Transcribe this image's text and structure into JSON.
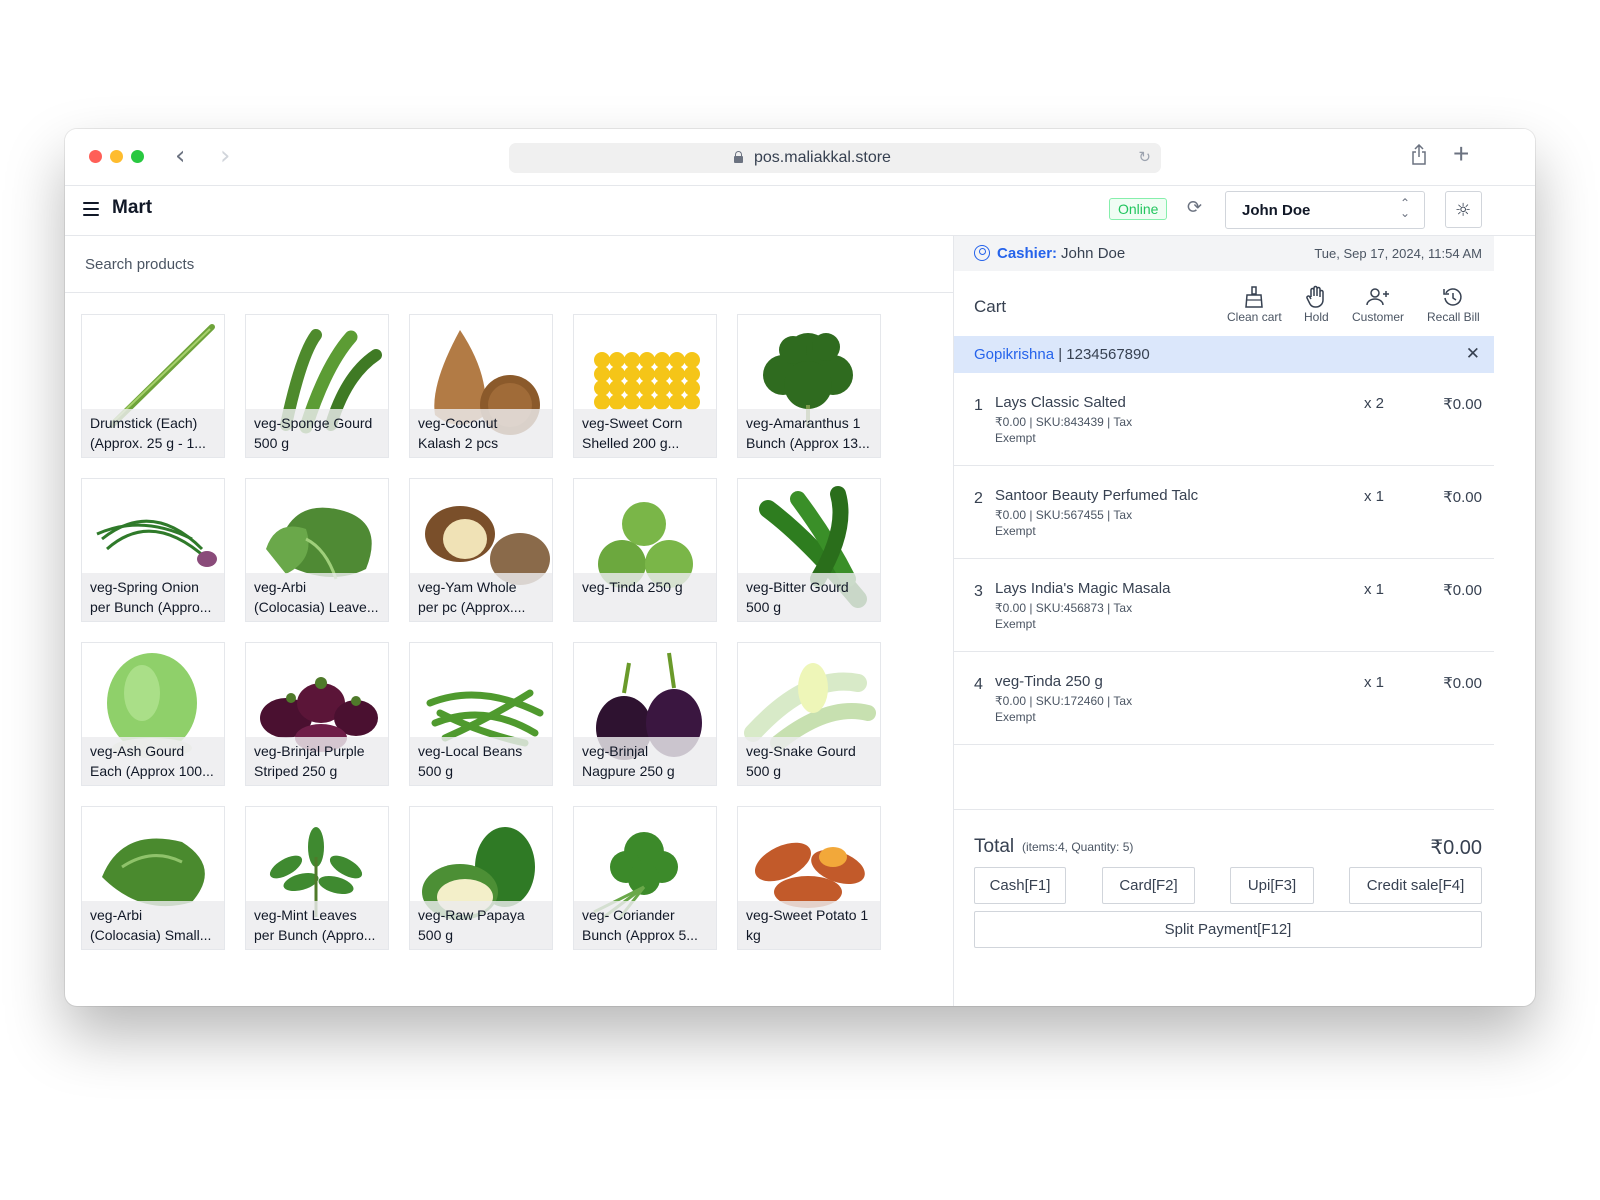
{
  "browser": {
    "url": "pos.maliakkal.store"
  },
  "header": {
    "brand": "Mart",
    "status": "Online",
    "user": "John Doe"
  },
  "search": {
    "placeholder": "Search products"
  },
  "products": [
    {
      "line1": "Drumstick (Each)",
      "line2": "(Approx. 25 g - 1...",
      "icon": "drumstick-image"
    },
    {
      "line1": "veg-Sponge Gourd",
      "line2": "500 g",
      "icon": "sponge-gourd-image"
    },
    {
      "line1": "veg-Coconut",
      "line2": "Kalash 2 pcs",
      "icon": "coconut-image"
    },
    {
      "line1": "veg-Sweet Corn",
      "line2": "Shelled 200 g...",
      "icon": "sweet-corn-image"
    },
    {
      "line1": "veg-Amaranthus 1",
      "line2": "Bunch (Approx 13...",
      "icon": "amaranthus-image"
    },
    {
      "line1": "veg-Spring Onion",
      "line2": "per Bunch (Appro...",
      "icon": "spring-onion-image"
    },
    {
      "line1": "veg-Arbi",
      "line2": "(Colocasia) Leave...",
      "icon": "arbi-leaves-image"
    },
    {
      "line1": "veg-Yam Whole",
      "line2": "per pc (Approx....",
      "icon": "yam-image"
    },
    {
      "line1": "veg-Tinda 250 g",
      "line2": "",
      "icon": "tinda-image"
    },
    {
      "line1": "veg-Bitter Gourd",
      "line2": "500 g",
      "icon": "bitter-gourd-image"
    },
    {
      "line1": "veg-Ash Gourd",
      "line2": "Each (Approx 100...",
      "icon": "ash-gourd-image"
    },
    {
      "line1": "veg-Brinjal Purple",
      "line2": "Striped 250 g",
      "icon": "brinjal-purple-image"
    },
    {
      "line1": "veg-Local Beans",
      "line2": "500 g",
      "icon": "beans-image"
    },
    {
      "line1": "veg-Brinjal",
      "line2": "Nagpure 250 g",
      "icon": "brinjal-nagpure-image"
    },
    {
      "line1": "veg-Snake Gourd",
      "line2": "500 g",
      "icon": "snake-gourd-image"
    },
    {
      "line1": "veg-Arbi",
      "line2": "(Colocasia) Small...",
      "icon": "arbi-small-image"
    },
    {
      "line1": "veg-Mint Leaves",
      "line2": "per Bunch (Appro...",
      "icon": "mint-image"
    },
    {
      "line1": "veg-Raw Papaya",
      "line2": "500 g",
      "icon": "papaya-image"
    },
    {
      "line1": "veg- Coriander",
      "line2": "Bunch (Approx 5...",
      "icon": "coriander-image"
    },
    {
      "line1": "veg-Sweet Potato 1",
      "line2": "kg",
      "icon": "sweet-potato-image"
    }
  ],
  "cashier": {
    "label": "Cashier:",
    "name": "John Doe",
    "datetime": "Tue, Sep 17, 2024, 11:54 AM"
  },
  "cart": {
    "title": "Cart",
    "actions": {
      "clean": "Clean cart",
      "hold": "Hold",
      "customer": "Customer",
      "recall": "Recall Bill"
    },
    "customer_name": "Gopikrishna",
    "customer_sep": " | ",
    "customer_phone": "1234567890",
    "items": [
      {
        "num": "1",
        "name": "Lays Classic Salted",
        "meta": "₹0.00 | SKU:843439 | Tax Exempt",
        "qty": "x 2",
        "price": "₹0.00"
      },
      {
        "num": "2",
        "name": "Santoor Beauty Perfumed Talc",
        "meta": "₹0.00 | SKU:567455 | Tax Exempt",
        "qty": "x 1",
        "price": "₹0.00"
      },
      {
        "num": "3",
        "name": "Lays India's Magic Masala",
        "meta": "₹0.00 | SKU:456873 | Tax Exempt",
        "qty": "x 1",
        "price": "₹0.00"
      },
      {
        "num": "4",
        "name": "veg-Tinda 250 g",
        "meta": "₹0.00 | SKU:172460 | Tax Exempt",
        "qty": "x 1",
        "price": "₹0.00"
      }
    ]
  },
  "totals": {
    "label": "Total",
    "meta": "(items:4, Quantity: 5)",
    "amount": "₹0.00"
  },
  "payments": {
    "cash": "Cash[F1]",
    "card": "Card[F2]",
    "upi": "Upi[F3]",
    "credit": "Credit sale[F4]",
    "split": "Split Payment[F12]"
  }
}
